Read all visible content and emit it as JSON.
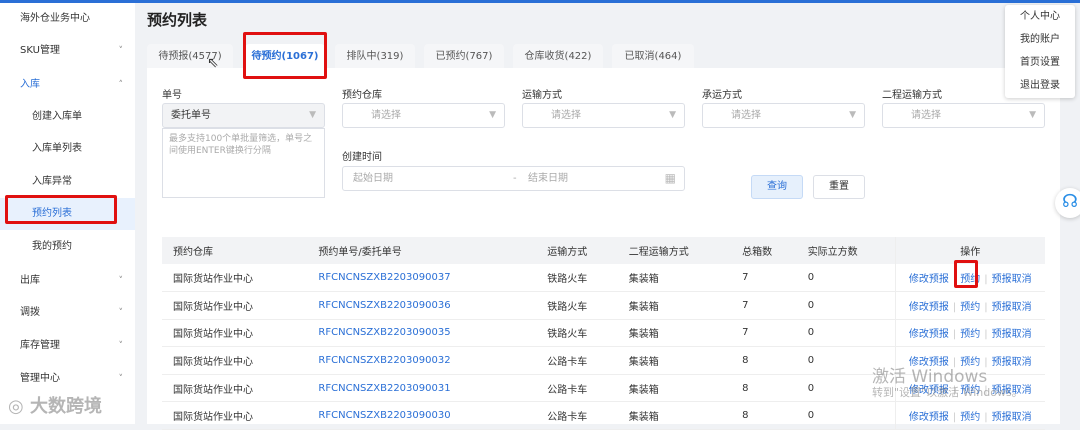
{
  "sidebar": {
    "items": [
      {
        "label": "海外仓业务中心"
      },
      {
        "label": "SKU管理"
      },
      {
        "label": "入库"
      },
      {
        "label": "创建入库单"
      },
      {
        "label": "入库单列表"
      },
      {
        "label": "入库异常"
      },
      {
        "label": "预约列表"
      },
      {
        "label": "我的预约"
      },
      {
        "label": "出库"
      },
      {
        "label": "调拨"
      },
      {
        "label": "库存管理"
      },
      {
        "label": "管理中心"
      }
    ]
  },
  "page": {
    "title": "预约列表"
  },
  "tabs": [
    {
      "label": "待预报(4577)"
    },
    {
      "label": "待预约(1067)"
    },
    {
      "label": "排队中(319)"
    },
    {
      "label": "已预约(767)"
    },
    {
      "label": "仓库收货(422)"
    },
    {
      "label": "已取消(464)"
    }
  ],
  "filters": {
    "order_no": {
      "label": "单号",
      "type_value": "委托单号",
      "placeholder": "最多支持100个单批量筛选，单号之间使用ENTER键换行分隔"
    },
    "warehouse": {
      "label": "预约仓库",
      "placeholder": "请选择"
    },
    "transport": {
      "label": "运输方式",
      "placeholder": "请选择"
    },
    "carrier": {
      "label": "承运方式",
      "placeholder": "请选择"
    },
    "second_transport": {
      "label": "二程运输方式",
      "placeholder": "请选择"
    },
    "created": {
      "label": "创建时间",
      "start_placeholder": "起始日期",
      "separator": "-",
      "end_placeholder": "结束日期"
    },
    "search_label": "查询",
    "reset_label": "重置"
  },
  "table": {
    "headers": [
      "预约仓库",
      "预约单号/委托单号",
      "运输方式",
      "二程运输方式",
      "总箱数",
      "实际立方数",
      "操作"
    ],
    "actions": [
      "修改预报",
      "预约",
      "预报取消"
    ],
    "rows": [
      [
        "国际货站作业中心",
        "RFCNCNSZXB2203090037",
        "铁路火车",
        "集装箱",
        "7",
        "0"
      ],
      [
        "国际货站作业中心",
        "RFCNCNSZXB2203090036",
        "铁路火车",
        "集装箱",
        "7",
        "0"
      ],
      [
        "国际货站作业中心",
        "RFCNCNSZXB2203090035",
        "铁路火车",
        "集装箱",
        "7",
        "0"
      ],
      [
        "国际货站作业中心",
        "RFCNCNSZXB2203090032",
        "公路卡车",
        "集装箱",
        "8",
        "0"
      ],
      [
        "国际货站作业中心",
        "RFCNCNSZXB2203090031",
        "公路卡车",
        "集装箱",
        "8",
        "0"
      ],
      [
        "国际货站作业中心",
        "RFCNCNSZXB2203090030",
        "公路卡车",
        "集装箱",
        "8",
        "0"
      ]
    ]
  },
  "user_menu": [
    "个人中心",
    "我的账户",
    "首页设置",
    "退出登录"
  ],
  "watermark": {
    "brand": "大数跨境",
    "win_title": "激活 Windows",
    "win_sub": "转到\"设置\"以激活 Windows。"
  }
}
